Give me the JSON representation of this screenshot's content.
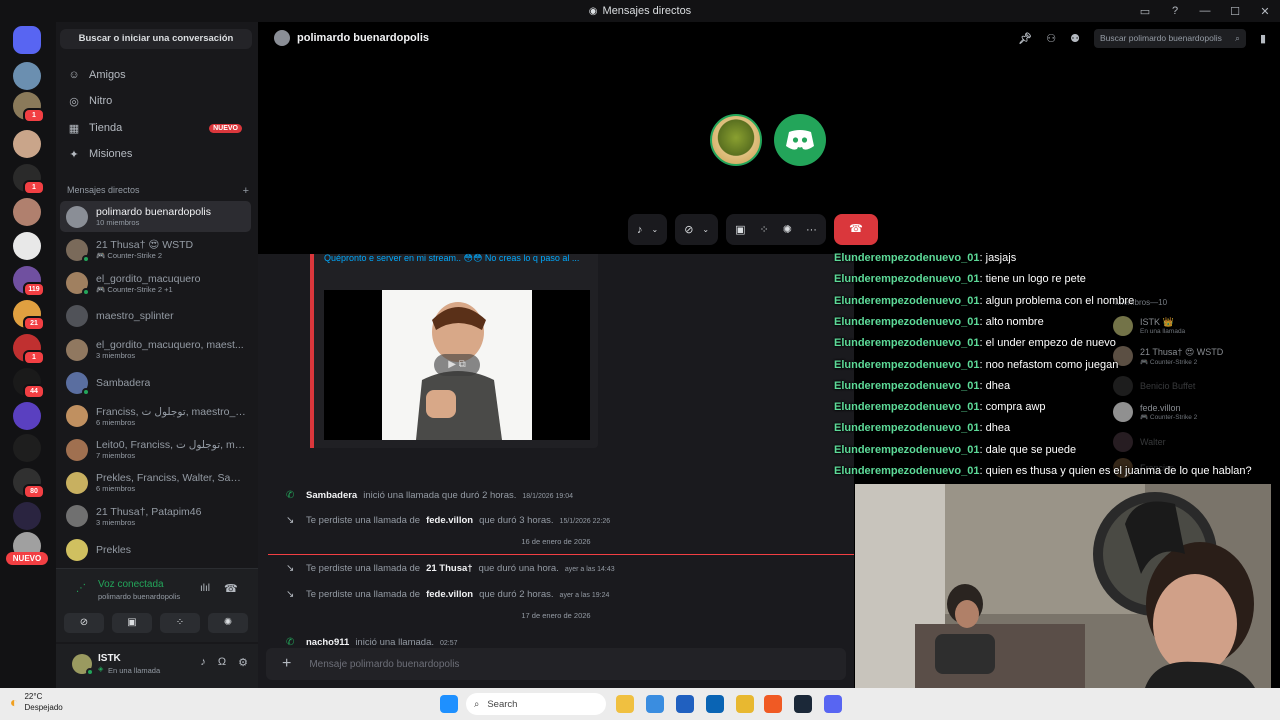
{
  "window": {
    "title": "Mensajes directos",
    "controls": [
      "inbox-icon",
      "help-icon",
      "minimize-icon",
      "maximize-icon",
      "close-icon"
    ]
  },
  "servers": [
    {
      "name": "discord-home",
      "color": "#5865f2",
      "badge": ""
    },
    {
      "name": "server-1",
      "color": "#6b8fb0",
      "badge": ""
    },
    {
      "name": "server-2",
      "color": "#8a7a5a",
      "badge": "1"
    },
    {
      "name": "server-3",
      "color": "#c9a58a",
      "badge": ""
    },
    {
      "name": "server-4",
      "color": "#2a2a2a",
      "badge": "1"
    },
    {
      "name": "server-5",
      "color": "#b0806e",
      "badge": ""
    },
    {
      "name": "server-6",
      "color": "#e8e8e8",
      "badge": ""
    },
    {
      "name": "server-7",
      "color": "#7050a0",
      "badge": "119"
    },
    {
      "name": "server-8",
      "color": "#e0a040",
      "badge": "21"
    },
    {
      "name": "server-9",
      "color": "#c03030",
      "badge": "1"
    },
    {
      "name": "server-10",
      "color": "#1a1a1a",
      "badge": "44"
    },
    {
      "name": "server-11",
      "color": "#5a40c0",
      "badge": ""
    },
    {
      "name": "server-12",
      "color": "#1e1e1e",
      "badge": ""
    },
    {
      "name": "server-13",
      "color": "#303030",
      "badge": "80"
    },
    {
      "name": "server-14",
      "color": "#2a2440",
      "badge": ""
    },
    {
      "name": "server-15",
      "color": "#a0a0a0",
      "badge": ""
    }
  ],
  "servers_new_label": "NUEVO",
  "dm_sidebar": {
    "search_label": "Buscar o iniciar una conversación",
    "nav": [
      {
        "icon": "friends-icon",
        "glyph": "☺",
        "label": "Amigos",
        "badge": ""
      },
      {
        "icon": "nitro-icon",
        "glyph": "◎",
        "label": "Nitro",
        "badge": ""
      },
      {
        "icon": "shop-icon",
        "glyph": "▦",
        "label": "Tienda",
        "badge": "NUEVO"
      },
      {
        "icon": "quests-icon",
        "glyph": "✦",
        "label": "Misiones",
        "badge": ""
      }
    ],
    "section_title": "Mensajes directos",
    "add_glyph": "+",
    "dms": [
      {
        "name": "polimardo buenardopolis",
        "sub": "10 miembros",
        "color": "#8a8e96",
        "active": true,
        "online": false
      },
      {
        "name": "21 Thusa† 😍 WSTD",
        "sub": "🎮 Counter-Strike 2",
        "color": "#7a6a5a",
        "active": false,
        "online": true
      },
      {
        "name": "el_gordito_macuquero",
        "sub": "🎮 Counter-Strike 2 +1",
        "color": "#a08060",
        "active": false,
        "online": true
      },
      {
        "name": "maestro_splinter",
        "sub": "",
        "color": "#505258",
        "active": false,
        "online": false
      },
      {
        "name": "el_gordito_macuquero, maest...",
        "sub": "3 miembros",
        "color": "#907860",
        "active": false,
        "online": false
      },
      {
        "name": "Sambadera",
        "sub": "",
        "color": "#5a6ea0",
        "active": false,
        "online": true
      },
      {
        "name": "Franciss, توجلول ت, maestro_sp...",
        "sub": "6 miembros",
        "color": "#c09060",
        "active": false,
        "online": false
      },
      {
        "name": "Leito0, Franciss, توجلول ت, mae...",
        "sub": "7 miembros",
        "color": "#a07050",
        "active": false,
        "online": false
      },
      {
        "name": "Prekles, Franciss, Walter, Sam...",
        "sub": "6 miembros",
        "color": "#c8b060",
        "active": false,
        "online": false
      },
      {
        "name": "21 Thusa†, Patapim46",
        "sub": "3 miembros",
        "color": "#707070",
        "active": false,
        "online": false
      },
      {
        "name": "Prekles",
        "sub": "",
        "color": "#d0c060",
        "active": false,
        "online": false
      }
    ],
    "voice": {
      "status": "Voz conectada",
      "channel": "polimardo buenardopolis",
      "buttons": [
        "camera-off-icon",
        "screen-share-icon",
        "activities-icon",
        "soundboard-icon"
      ],
      "glyphs": [
        "⊘",
        "▣",
        "⁘",
        "✺"
      ]
    },
    "user": {
      "name": "ISTK",
      "status": "En una llamada"
    }
  },
  "channel": {
    "title": "polimardo buenardopolis",
    "search_placeholder": "Buscar polimardo buenardopolis"
  },
  "call": {
    "controls": [
      "mic-icon",
      "camera-off-icon",
      "screen-share-icon",
      "activities-icon",
      "soundboard-icon",
      "more-icon"
    ],
    "hangup": "hang-up-icon"
  },
  "embed": {
    "text": "Quépronto e server en mi stream.. 😳😳 No creas lo q paso al ..."
  },
  "messages": [
    {
      "kind": "call",
      "icon": "✆",
      "green": true,
      "author": "Sambadera",
      "text": "inició una llamada que duró 2 horas.",
      "ts": "18/1/2026 19:04"
    },
    {
      "kind": "missed",
      "icon": "↘",
      "green": false,
      "pre": "Te perdiste una llamada de",
      "author": "fede.villon",
      "text": "que duró 3 horas.",
      "ts": "15/1/2026 22:26"
    },
    {
      "kind": "missed",
      "icon": "↘",
      "green": false,
      "pre": "Te perdiste una llamada de",
      "author": "21 Thusa†",
      "text": "que duró una hora.",
      "ts": "ayer a las 14:43"
    },
    {
      "kind": "missed",
      "icon": "↘",
      "green": false,
      "pre": "Te perdiste una llamada de",
      "author": "fede.villon",
      "text": "que duró 2 horas.",
      "ts": "ayer a las 19:24"
    },
    {
      "kind": "call",
      "icon": "✆",
      "green": true,
      "author": "nacho911",
      "text": "inició una llamada.",
      "ts": "02:57"
    }
  ],
  "dividers": [
    "16 de enero de 2026",
    "17 de enero de 2026"
  ],
  "composer": {
    "placeholder": "Mensaje polimardo buenardopolis",
    "plus": "+"
  },
  "members": {
    "header": "Miembros—10",
    "list": [
      {
        "name": "ISTK 👑",
        "sub": "En una llamada",
        "color": "#9a9a60"
      },
      {
        "name": "21 Thusa† 😍 WSTD",
        "sub": "🎮 Counter-Strike 2",
        "color": "#7a6a5a"
      },
      {
        "name": "Benicio Buffet",
        "sub": "",
        "color": "#606060"
      },
      {
        "name": "fede.villon",
        "sub": "🎮 Counter-Strike 2",
        "color": "#c0c0c0"
      },
      {
        "name": "Walter",
        "sub": "",
        "color": "#806070"
      },
      {
        "name": "Franciss",
        "sub": "",
        "color": "#b08050"
      }
    ]
  },
  "stream_chat": [
    {
      "user": "Elunderempezodenuevo_01",
      "text": "jasjajs"
    },
    {
      "user": "Elunderempezodenuevo_01",
      "text": "tiene un logo re pete"
    },
    {
      "user": "Elunderempezodenuevo_01",
      "text": "algun problema con el nombre"
    },
    {
      "user": "Elunderempezodenuevo_01",
      "text": "alto nombre"
    },
    {
      "user": "Elunderempezodenuevo_01",
      "text": "el under empezo de nuevo"
    },
    {
      "user": "Elunderempezodenuevo_01",
      "text": "noo nefastom como juegan"
    },
    {
      "user": "Elunderempezodenuevo_01",
      "text": "dhea"
    },
    {
      "user": "Elunderempezodenuevo_01",
      "text": "compra awp"
    },
    {
      "user": "Elunderempezodenuevo_01",
      "text": "dhea"
    },
    {
      "user": "Elunderempezodenuevo_01",
      "text": "dale que se puede"
    },
    {
      "user": "Elunderempezodenuevo_01",
      "text": "quien es thusa y quien es el juanma de lo que hablan?"
    }
  ],
  "taskbar": {
    "weather_temp": "22°C",
    "weather_desc": "Despejado",
    "search_label": "Search",
    "apps": [
      {
        "icon": "windows-start-icon",
        "color": "#1e90ff"
      },
      {
        "icon": "file-explorer-icon",
        "color": "#f0c040"
      },
      {
        "icon": "copilot-icon",
        "color": "#3a8de0"
      },
      {
        "icon": "store-icon",
        "color": "#2060c0"
      },
      {
        "icon": "outlook-icon",
        "color": "#0a64b4"
      },
      {
        "icon": "folder-icon",
        "color": "#e8b830"
      },
      {
        "icon": "brave-icon",
        "color": "#f05a24"
      },
      {
        "icon": "steam-icon",
        "color": "#1b2838"
      },
      {
        "icon": "discord-taskbar-icon",
        "color": "#5865f2"
      }
    ]
  }
}
